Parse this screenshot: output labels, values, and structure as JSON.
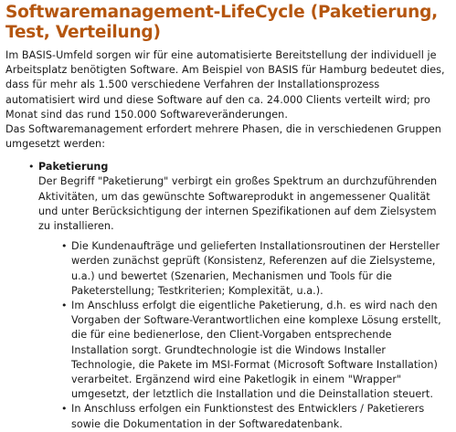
{
  "heading": "Softwaremanagement-LifeCycle (Paketierung, Test, Verteilung)",
  "intro": [
    "Im BASIS-Umfeld sorgen wir für eine automatisierte Bereitstellung der individuell je Arbeitsplatz benötigten Software. Am Beispiel von BASIS für Hamburg bedeutet dies, dass für mehr als 1.500 verschiedene Verfahren der Installationsprozess automatisiert wird und diese Software auf den ca. 24.000 Clients verteilt wird; pro Monat sind das rund 150.000 Softwareveränderungen.",
    "Das Softwaremanagement erfordert mehrere Phasen, die in verschiedenen Gruppen umgesetzt werden:"
  ],
  "phases": [
    {
      "title": "Paketierung",
      "text": "Der Begriff \"Paketierung\" verbirgt ein großes Spektrum an durchzuführenden Aktivitäten, um das gewünschte Softwareprodukt in angemessener Qualität und unter Berücksichtigung der internen Spezifikationen auf dem Zielsystem zu installieren.",
      "steps": [
        "Die Kundenaufträge und gelieferten Installationsroutinen der Hersteller werden zunächst geprüft (Konsistenz, Referenzen auf die Zielsysteme, u.a.) und bewertet (Szenarien, Mechanismen und Tools für die Paketerstellung; Testkriterien; Komplexität, u.a.).",
        "Im Anschluss erfolgt die eigentliche Paketierung, d.h. es wird nach den Vorgaben der Software-Verantwortlichen eine komplexe Lösung erstellt, die für eine bedienerlose, den Client-Vorgaben entsprechende Installation sorgt. Grundtechnologie ist die Windows Installer Technologie, die Pakete im MSI-Format (Microsoft Software Installation) verarbeitet. Ergänzend wird eine Paketlogik in einem \"Wrapper\" umgesetzt, der letztlich die Installation und die Deinstallation steuert.",
        "In Anschluss erfolgen ein Funktionstest des Entwicklers / Paketierers sowie die Dokumentation in der Softwaredatenbank."
      ]
    }
  ],
  "bullet_glyph": "•",
  "colors": {
    "heading": "#b5560f",
    "text": "#1a1a1a",
    "background": "#ffffff"
  }
}
